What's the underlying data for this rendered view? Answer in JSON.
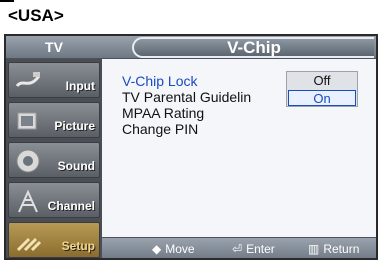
{
  "region_label": "<USA>",
  "osd": {
    "source_tab": "TV",
    "title": "V-Chip",
    "sidebar": [
      {
        "label": "Input",
        "icon": "input-cable-icon"
      },
      {
        "label": "Picture",
        "icon": "picture-tv-icon"
      },
      {
        "label": "Sound",
        "icon": "speaker-icon"
      },
      {
        "label": "Channel",
        "icon": "antenna-icon"
      },
      {
        "label": "Setup",
        "icon": "setup-tools-icon"
      }
    ],
    "menu": {
      "items": [
        "V-Chip Lock",
        "TV Parental Guidelin",
        "MPAA Rating",
        "Change PIN"
      ],
      "selected": "V-Chip Lock",
      "lock_options": [
        "Off",
        "On"
      ],
      "lock_value": "On"
    },
    "hints": [
      {
        "glyph": "◆",
        "label": "Move"
      },
      {
        "glyph": "⏎",
        "label": "Enter"
      },
      {
        "glyph": "▥",
        "label": "Return"
      }
    ]
  },
  "colors": {
    "accent": "#1a4bbf",
    "active_item": "#b89a55"
  }
}
